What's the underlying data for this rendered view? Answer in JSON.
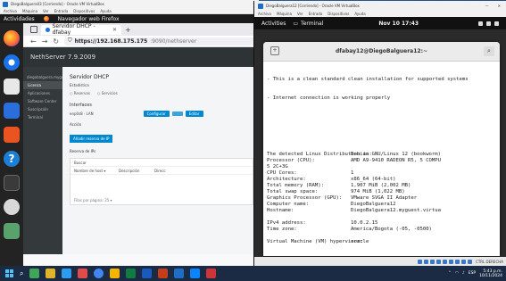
{
  "left_vm": {
    "titlebar": "DiegoBalguera03 [Corriendo] - Oracle VM VirtualBox",
    "menu": [
      "Archivo",
      "Máquina",
      "Ver",
      "Entrada",
      "Dispositivos",
      "Ayuda"
    ],
    "topbar": {
      "activities": "Actividades",
      "app": "Navegador web Firefox"
    },
    "firefox": {
      "tab_label": "Servidor DHCP - dfabay",
      "url_host": "https://192.168.175.175",
      "url_path": ":9090/nethserver"
    },
    "nethserver": {
      "version": "NethServer 7.9.2009",
      "hostname": "diegobalguera.mygu...",
      "sidebar_items": [
        "Licenza",
        "Aplicaciones",
        "Software Center",
        "Suscripción",
        "Terminal"
      ],
      "page_title": "Servidor DHCP",
      "status_label": "Estadística",
      "radio_options": [
        "Reservas",
        "Servicios"
      ],
      "interfaces_label": "Interfaces",
      "iface_name": "enp0s8 · LAN",
      "configure_btn": "Configurar",
      "edit_btn": "Editar",
      "actions_label": "Acción",
      "add_reservation_btn": "Añadir reserva de IP",
      "ip_reservations_label": "Reserva de IPs",
      "search_placeholder": "Buscar",
      "col_host": "Nombre de host ▾",
      "col_desc": "Descripción",
      "col_dir": "Direcc",
      "pagination": "Filas por página: 25 ▾"
    }
  },
  "right_vm": {
    "titlebar": "DiegoBalguera12 [Corriendo] - Oracle VM VirtualBox",
    "menu": [
      "Archivo",
      "Máquina",
      "Ver",
      "Entrada",
      "Dispositivos",
      "Ayuda"
    ],
    "controls": {
      "minimize": "—",
      "close": "✕"
    },
    "topbar": {
      "activities": "Activities",
      "terminal": "Terminal",
      "clock": "Nov 10  17:43"
    },
    "terminal": {
      "title": "dfabay12@DiegoBalguera12:~",
      "intro": [
        "- This is a clean standard clean installation for supported systems",
        "- Internet connection is working properly"
      ],
      "info": [
        {
          "k": "The detected Linux Distribution is:",
          "v": "Debian GNU/Linux 12 (bookworm)"
        },
        {
          "k": "Processor (CPU):",
          "v": "AMD A9-9410 RADEON R5, 5 COMPU"
        },
        {
          "k": "5 2C+3G",
          "v": ""
        },
        {
          "k": "CPU Cores:",
          "v": "1"
        },
        {
          "k": "Architecture:",
          "v": "x86_64 (64-bit)"
        },
        {
          "k": "Total memory (RAM):",
          "v": "1,907 MiB (2,002 MB)"
        },
        {
          "k": "Total swap space:",
          "v": "974 MiB (1,022 MB)"
        },
        {
          "k": "Graphics Processor (GPU):",
          "v": "VMware SVGA II Adapter"
        },
        {
          "k": "Computer name:",
          "v": "DiegoBalguera12"
        },
        {
          "k": "Hostname:",
          "v": "DiegoBalguera12.myguest.virtua"
        },
        {
          "k": "IPv4 address:",
          "v": "10.0.2.15"
        },
        {
          "k": "Time zone:",
          "v": "America/Bogota (-05, -0500)"
        },
        {
          "k": "Virtual Machine (VM) hypervisor:",
          "v": "oracle"
        }
      ]
    },
    "status_key": "CTRL DERECHA"
  },
  "taskbar": {
    "tray_lang": "ESP",
    "time": "5:43 p.m.",
    "date": "10/11/2024"
  }
}
